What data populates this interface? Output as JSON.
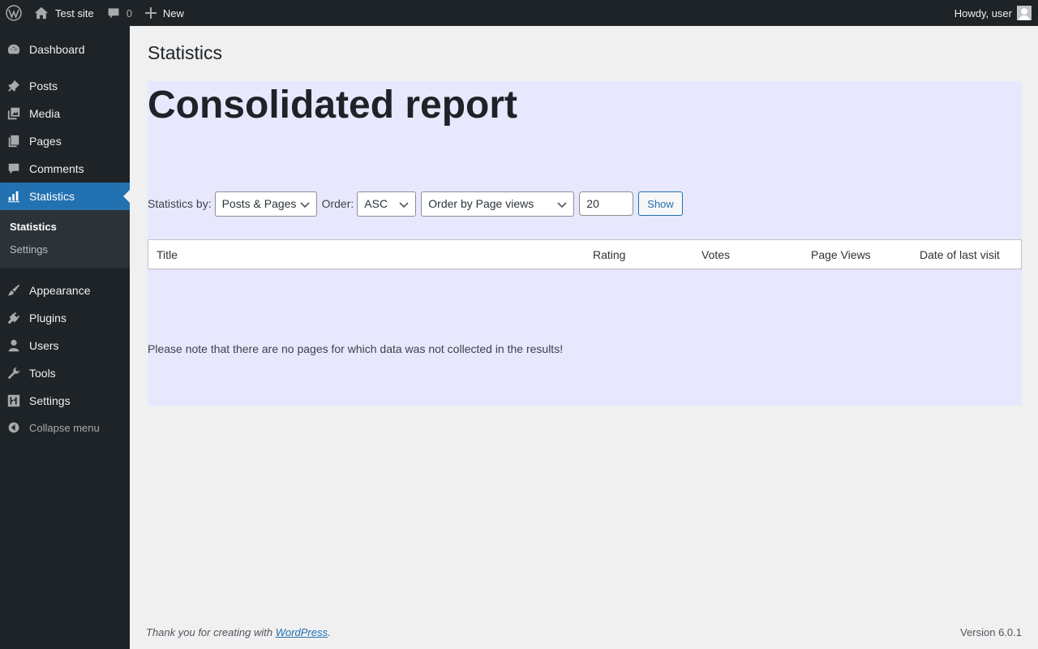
{
  "adminbar": {
    "site_name": "Test site",
    "comments_count": "0",
    "new_label": "New",
    "greeting": "Howdy, user"
  },
  "sidebar": {
    "items": [
      {
        "label": "Dashboard",
        "icon": "dashboard-icon"
      },
      {
        "label": "Posts",
        "icon": "pin-icon"
      },
      {
        "label": "Media",
        "icon": "media-icon"
      },
      {
        "label": "Pages",
        "icon": "pages-icon"
      },
      {
        "label": "Comments",
        "icon": "comment-icon"
      },
      {
        "label": "Statistics",
        "icon": "bar-chart-icon",
        "active": true
      },
      {
        "label": "Appearance",
        "icon": "brush-icon"
      },
      {
        "label": "Plugins",
        "icon": "plug-icon"
      },
      {
        "label": "Users",
        "icon": "user-icon"
      },
      {
        "label": "Tools",
        "icon": "wrench-icon"
      },
      {
        "label": "Settings",
        "icon": "sliders-icon"
      }
    ],
    "submenu": [
      "Statistics",
      "Settings"
    ],
    "collapse_label": "Collapse menu"
  },
  "page": {
    "title": "Statistics",
    "report_title": "Consolidated report"
  },
  "filters": {
    "stats_by_label": "Statistics by:",
    "stats_by_value": "Posts & Pages",
    "order_label": "Order:",
    "order_value": "ASC",
    "order_by_value": "Order by Page views",
    "limit_value": "20",
    "show_button": "Show"
  },
  "table": {
    "columns": [
      "Title",
      "Rating",
      "Votes",
      "Page Views",
      "Date of last visit"
    ]
  },
  "note": "Please note that there are no pages for which data was not collected in the results!",
  "footer": {
    "thanks_prefix": "Thank you for creating with ",
    "thanks_link": "WordPress",
    "thanks_suffix": ".",
    "version": "Version 6.0.1"
  },
  "colors": {
    "adminbar_bg": "#1d2327",
    "accent": "#2271b1",
    "panel_bg": "#e7e8fd",
    "page_bg": "#f0f0f1"
  }
}
